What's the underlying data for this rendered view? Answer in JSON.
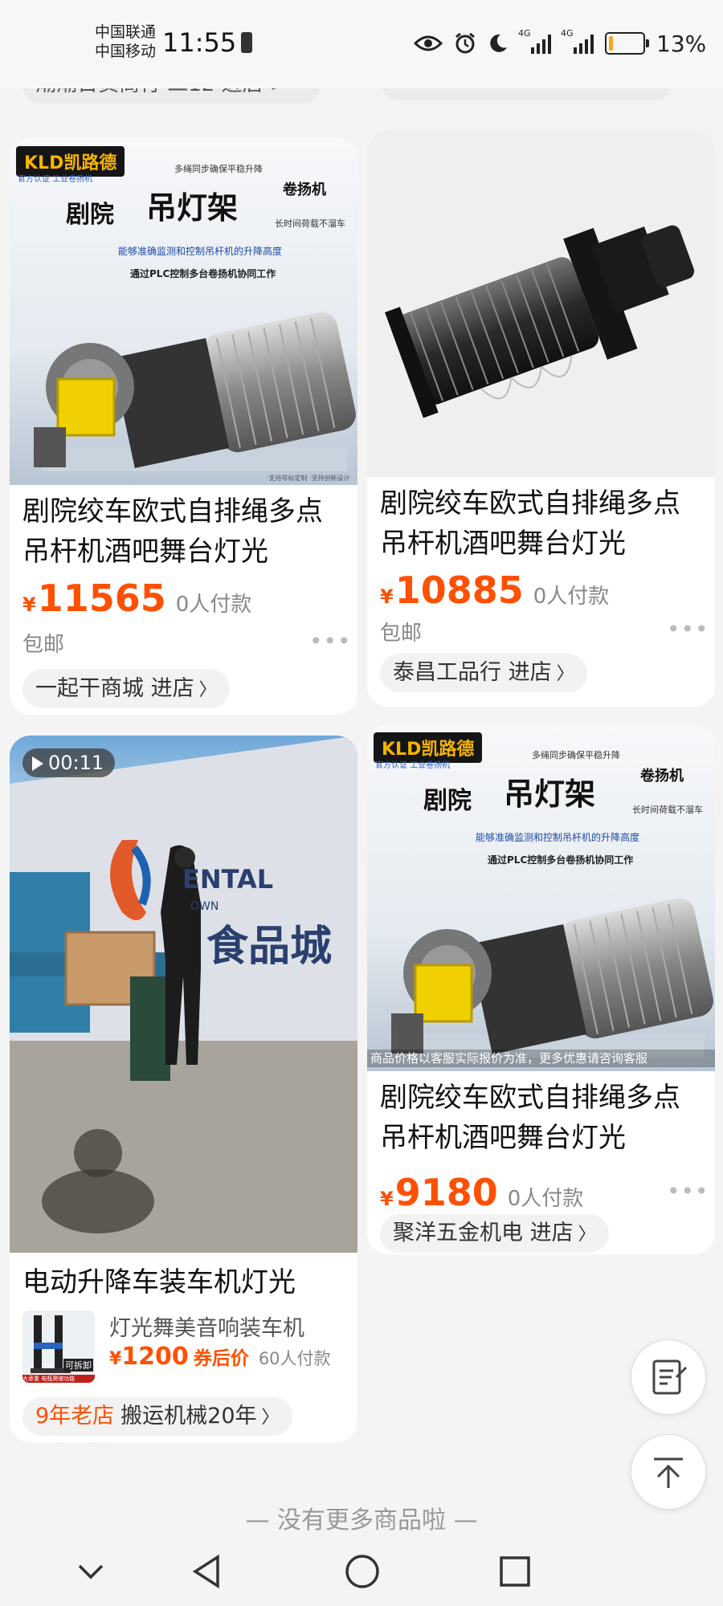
{
  "status_bar": {
    "carrier1": "中国联通",
    "carrier2": "中国移动",
    "time": "11:55",
    "network1": "4G",
    "network2": "4G",
    "battery_pct": "13%",
    "battery_level": 0.13,
    "battery_color": "#f5a623"
  },
  "previous_row": {
    "shop_partial": "潮潮日货商行 二12 进店 >"
  },
  "accent_color": "#ff5000",
  "products": [
    {
      "title": "剧院绞车欧式自排绳多点吊杆机酒吧舞台灯光",
      "yen": "¥",
      "price": "11565",
      "paid": "0人付款",
      "shipping": "包邮",
      "shop": "一起干商城 进店",
      "image": {
        "brand": "KLD凯路德",
        "brand_sub": "官方认证  工业卷扬机",
        "tag1": "多绳同步确保平稳升降",
        "word1": "剧院",
        "word2": "吊灯架",
        "word3": "卷扬机",
        "tag2": "长时间荷载不溜车",
        "line1": "能够准确监测和控制吊杆机的升降高度",
        "line2": "通过PLC控制多台卷扬机协同工作",
        "foot": "·支持非标定制  ·坚持创新设计"
      }
    },
    {
      "title": "剧院绞车欧式自排绳多点吊杆机酒吧舞台灯光",
      "yen": "¥",
      "price": "10885",
      "paid": "0人付款",
      "shipping": "包邮",
      "shop": "泰昌工品行 进店"
    },
    {
      "video_duration": "00:11",
      "title": "电动升降车装车机灯光",
      "related_title": "灯光舞美音响装车机",
      "yen": "¥",
      "price": "1200",
      "coupon": "券后价",
      "paid": "60人付款",
      "shop_age": "9年老店",
      "shop": "搬运机械20年",
      "image": {
        "sign_en": "ENTAL",
        "sign_en2": "OWN",
        "sign_cn": "食品城",
        "thumb_tag": "可拆卸",
        "thumb_foot": "大承重 电瓶爬坡功能"
      }
    },
    {
      "title": "剧院绞车欧式自排绳多点吊杆机酒吧舞台灯光",
      "yen": "¥",
      "price": "9180",
      "paid": "0人付款",
      "shop": "聚洋五金机电 进店",
      "image": {
        "brand": "KLD凯路德",
        "brand_sub": "官方认证  工业卷扬机",
        "tag1": "多绳同步确保平稳升降",
        "word1": "剧院",
        "word2": "吊灯架",
        "word3": "卷扬机",
        "tag2": "长时间荷载不溜车",
        "line1": "能够准确监测和控制吊杆机的升降高度",
        "line2": "通过PLC控制多台卷扬机协同工作",
        "disclaimer": "商品价格以客服实际报价为准，更多优惠请咨询客服"
      }
    }
  ],
  "end_text": "— 没有更多商品啦 —",
  "icons": {
    "edit": "edit-note-icon",
    "top": "back-to-top-icon",
    "nav_down": "chevron-down-icon",
    "nav_back": "back-triangle-icon",
    "nav_home": "home-circle-icon",
    "nav_recent": "recent-square-icon"
  }
}
